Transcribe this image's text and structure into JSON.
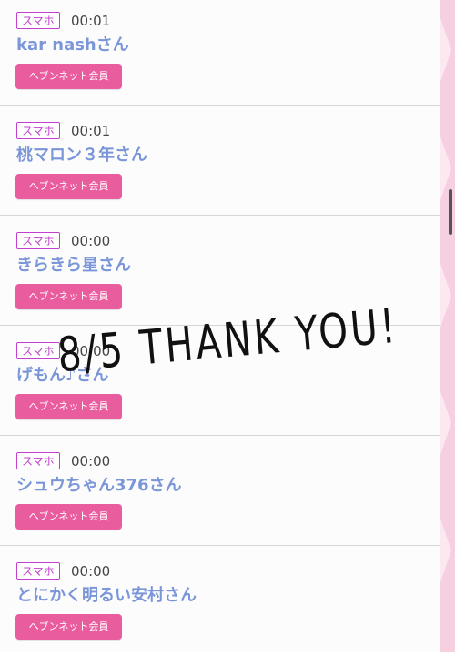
{
  "entries": [
    {
      "device": "スマホ",
      "time": "00:01",
      "name": "kar   nashさん",
      "member_label": "ヘブンネット会員"
    },
    {
      "device": "スマホ",
      "time": "00:01",
      "name": "桃マロン３年さん",
      "member_label": "ヘブンネット会員"
    },
    {
      "device": "スマホ",
      "time": "00:00",
      "name": "きらきら星さん",
      "member_label": "ヘブンネット会員"
    },
    {
      "device": "スマホ",
      "time": "00:00",
      "name": "げもん♪さん",
      "member_label": "ヘブンネット会員"
    },
    {
      "device": "スマホ",
      "time": "00:00",
      "name": "シュウちゃん376さん",
      "member_label": "ヘブンネット会員"
    },
    {
      "device": "スマホ",
      "time": "00:00",
      "name": "とにかく明るい安村さん",
      "member_label": "ヘブンネット会員"
    }
  ],
  "overlay": {
    "text": "8/5 THANK YOU!",
    "color": "#111111"
  },
  "colors": {
    "badge": "#c23fd0",
    "name": "#7a96d8",
    "member_button": "#e95c9e",
    "sidebar": "#f6cfe0"
  }
}
